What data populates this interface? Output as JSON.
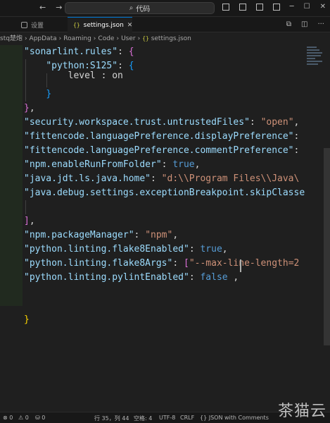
{
  "titlebar": {
    "search_text": "代码",
    "back": "←",
    "forward": "→"
  },
  "tabs": [
    {
      "label": "设置",
      "active": false
    },
    {
      "label": "settings.json",
      "active": true,
      "icon": "{}"
    }
  ],
  "breadcrumb": [
    "stq楚炮",
    "AppData",
    "Roaming",
    "Code",
    "User",
    "settings.json"
  ],
  "editor": {
    "lines": [
      [
        {
          "t": "\"sonarlint.rules\"",
          "c": "k"
        },
        {
          "t": ": ",
          "c": "p"
        },
        {
          "t": "{",
          "c": "br2"
        }
      ],
      [
        {
          "t": "    ",
          "c": "p"
        },
        {
          "t": "\"python:S125\"",
          "c": "k"
        },
        {
          "t": ": ",
          "c": "p"
        },
        {
          "t": "{",
          "c": "br3"
        }
      ],
      [
        {
          "t": "        level : on",
          "c": "p"
        }
      ],
      [
        {
          "t": "    ",
          "c": "p"
        },
        {
          "t": "}",
          "c": "br3"
        }
      ],
      [
        {
          "t": "}",
          "c": "br2"
        },
        {
          "t": ",",
          "c": "p"
        }
      ],
      [
        {
          "t": "\"security.workspace.trust.untrustedFiles\"",
          "c": "k"
        },
        {
          "t": ": ",
          "c": "p"
        },
        {
          "t": "\"open\"",
          "c": "s"
        },
        {
          "t": ",",
          "c": "p"
        }
      ],
      [
        {
          "t": "\"fittencode.languagePreference.displayPreference\"",
          "c": "k"
        },
        {
          "t": ":",
          "c": "p"
        }
      ],
      [
        {
          "t": "\"fittencode.languagePreference.commentPreference\"",
          "c": "k"
        },
        {
          "t": ":",
          "c": "p"
        }
      ],
      [
        {
          "t": "\"npm.enableRunFromFolder\"",
          "c": "k"
        },
        {
          "t": ": ",
          "c": "p"
        },
        {
          "t": "true",
          "c": "b"
        },
        {
          "t": ",",
          "c": "p"
        }
      ],
      [
        {
          "t": "\"java.jdt.ls.java.home\"",
          "c": "k"
        },
        {
          "t": ": ",
          "c": "p"
        },
        {
          "t": "\"d:\\\\Program Files\\\\Java\\",
          "c": "s"
        }
      ],
      [
        {
          "t": "\"java.debug.settings.exceptionBreakpoint.skipClasse",
          "c": "k"
        }
      ],
      [
        {
          "t": "",
          "c": "p"
        }
      ],
      [
        {
          "t": "]",
          "c": "br2"
        },
        {
          "t": ",",
          "c": "p"
        }
      ],
      [
        {
          "t": "\"npm.packageManager\"",
          "c": "k"
        },
        {
          "t": ": ",
          "c": "p"
        },
        {
          "t": "\"npm\"",
          "c": "s"
        },
        {
          "t": ",",
          "c": "p"
        }
      ],
      [
        {
          "t": "\"python.linting.flake8Enabled\"",
          "c": "k"
        },
        {
          "t": ": ",
          "c": "p"
        },
        {
          "t": "true",
          "c": "b"
        },
        {
          "t": ",",
          "c": "p"
        }
      ],
      [
        {
          "t": "\"python.linting.flake8Args\"",
          "c": "k"
        },
        {
          "t": ": ",
          "c": "p"
        },
        {
          "t": "[",
          "c": "br2"
        },
        {
          "t": "\"--max-line-length=2",
          "c": "s"
        }
      ],
      [
        {
          "t": "\"python.linting.pylintEnabled\"",
          "c": "k"
        },
        {
          "t": ": ",
          "c": "p"
        },
        {
          "t": "false",
          "c": "b"
        },
        {
          "t": " ,",
          "c": "p"
        }
      ],
      [
        {
          "t": "",
          "c": "p"
        }
      ],
      [
        {
          "t": "",
          "c": "p"
        }
      ],
      [
        {
          "t": "}",
          "c": "br1"
        }
      ]
    ]
  },
  "statusbar": {
    "errors": "⊗ 0",
    "warnings": "⚠ 0",
    "ports": "⛁ 0",
    "position": "行 35，列 44",
    "spaces": "空格: 4",
    "encoding": "UTF-8",
    "eol": "CRLF",
    "language": "{} JSON with Comments"
  },
  "watermark": "茶猫云",
  "colors": {
    "background": "#1f1f1f",
    "key": "#9cdcfe",
    "string": "#ce9178",
    "boolean": "#569cd6",
    "accent": "#0078d4"
  }
}
